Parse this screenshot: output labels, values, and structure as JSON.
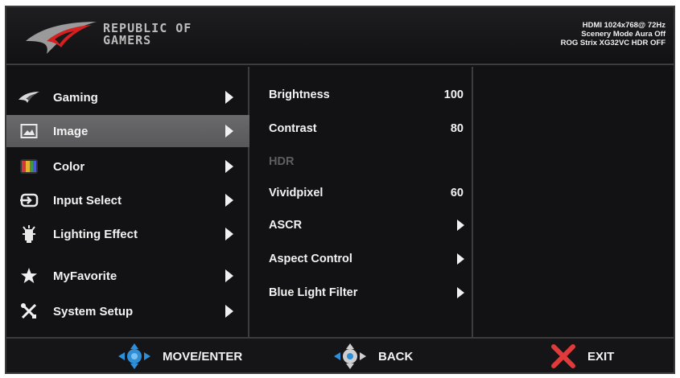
{
  "header": {
    "brand_line1": "REPUBLIC OF",
    "brand_line2": "GAMERS",
    "status_line1": "HDMI 1024x768@ 72Hz",
    "status_line2": "Scenery Mode Aura Off",
    "status_line3": "ROG Strix XG32VC HDR OFF"
  },
  "main_menu": [
    {
      "label": "Gaming",
      "icon": "rog-eye-icon",
      "selected": false
    },
    {
      "label": "Image",
      "icon": "image-icon",
      "selected": true
    },
    {
      "label": "Color",
      "icon": "color-palette-icon",
      "selected": false
    },
    {
      "label": "Input Select",
      "icon": "input-select-icon",
      "selected": false
    },
    {
      "label": "Lighting Effect",
      "icon": "lighting-effect-icon",
      "selected": false
    },
    {
      "label": "MyFavorite",
      "icon": "star-icon",
      "selected": false
    },
    {
      "label": "System Setup",
      "icon": "tools-icon",
      "selected": false
    }
  ],
  "submenu": [
    {
      "label": "Brightness",
      "value": "100"
    },
    {
      "label": "Contrast",
      "value": "80"
    },
    {
      "label": "HDR",
      "value": "",
      "disabled": true
    },
    {
      "label": "Vividpixel",
      "value": "60"
    },
    {
      "label": "ASCR",
      "value": "",
      "has_arrow": true
    },
    {
      "label": "Aspect Control",
      "value": "",
      "has_arrow": true
    },
    {
      "label": "Blue Light Filter",
      "value": "",
      "has_arrow": true
    }
  ],
  "footer": {
    "move_enter": "MOVE/ENTER",
    "back": "BACK",
    "exit": "EXIT"
  },
  "colors": {
    "background": "#121214",
    "selected_row": "#606062",
    "nav_blue": "#2f8fd6",
    "exit_red": "#e03a3a",
    "disabled_text": "#5e5e5e"
  }
}
